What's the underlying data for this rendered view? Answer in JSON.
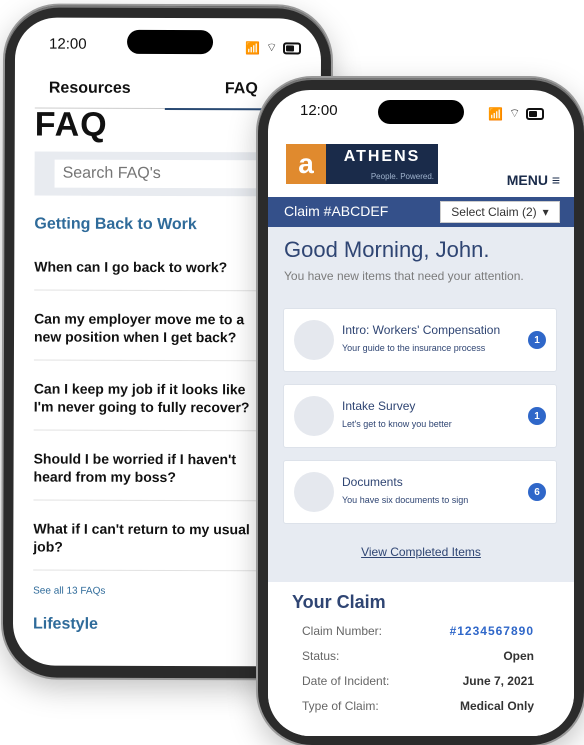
{
  "back_phone": {
    "status": {
      "time": "12:00"
    },
    "tabs": [
      {
        "label": "Resources"
      },
      {
        "label": "FAQ"
      }
    ],
    "title": "FAQ",
    "search": {
      "placeholder": "Search FAQ's"
    },
    "sections": [
      {
        "title": "Getting Back to Work"
      },
      {
        "title": "Lifestyle"
      }
    ],
    "questions": [
      {
        "text": "When can I go back to work?"
      },
      {
        "text": "Can my employer move me to a new position when I get back?"
      },
      {
        "text": "Can I keep my job if it looks like I'm never going to fully recover?"
      },
      {
        "text": "Should I be worried if I haven't heard from my boss?"
      },
      {
        "text": "What if I can't return to my usual job?"
      }
    ],
    "see_all": "See all 13 FAQs"
  },
  "front_phone": {
    "status": {
      "time": "12:00"
    },
    "brand": {
      "initial": "a",
      "name": "ATHENS",
      "tagline": "People. Powered."
    },
    "menu_label": "MENU ≡",
    "claim": {
      "id": "Claim #ABCDEF",
      "select_label": "Select Claim (2)"
    },
    "greeting": "Good Morning, John.",
    "subtext": "You have new items that need your attention.",
    "cards": [
      {
        "title": "Intro: Workers' Compensation",
        "subtitle": "Your guide to the insurance process",
        "badge": "1"
      },
      {
        "title": "Intake Survey",
        "subtitle": "Let's get to know you better",
        "badge": "1"
      },
      {
        "title": "Documents",
        "subtitle": "You have six documents to sign",
        "badge": "6"
      }
    ],
    "view_completed": "View Completed Items",
    "your_claim": {
      "title": "Your Claim",
      "rows": [
        {
          "label": "Claim Number:",
          "value": "#1234567890"
        },
        {
          "label": "Status:",
          "value": "Open"
        },
        {
          "label": "Date of Incident:",
          "value": "June 7, 2021"
        },
        {
          "label": "Type of Claim:",
          "value": "Medical Only"
        }
      ]
    }
  },
  "colors": {
    "brand_navy": "#1a2b4a",
    "accent_orange": "#e08a2e",
    "link_blue": "#2f6b9a",
    "badge_blue": "#2f67c9"
  }
}
